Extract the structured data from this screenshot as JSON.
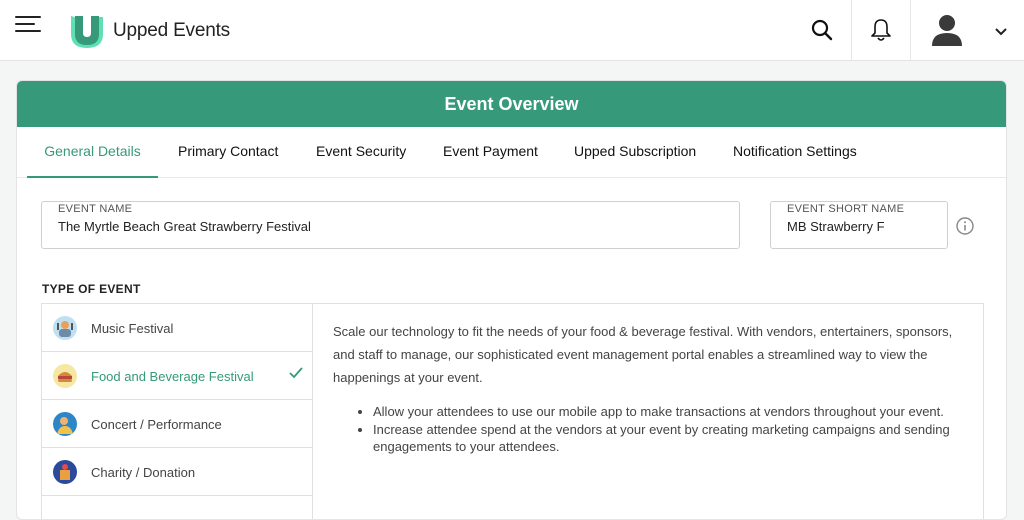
{
  "header": {
    "brand": "Upped Events",
    "icons": [
      "menu-icon",
      "upped-logo",
      "search-icon",
      "bell-icon",
      "user-avatar-icon",
      "chevron-down-icon"
    ]
  },
  "card": {
    "title": "Event Overview"
  },
  "tabs": [
    {
      "label": "General Details",
      "active": true
    },
    {
      "label": "Primary Contact",
      "active": false
    },
    {
      "label": "Event Security",
      "active": false
    },
    {
      "label": "Event Payment",
      "active": false
    },
    {
      "label": "Upped Subscription",
      "active": false
    },
    {
      "label": "Notification Settings",
      "active": false
    }
  ],
  "form": {
    "event_name": {
      "label": "EVENT NAME",
      "value": "The Myrtle Beach Great Strawberry Festival"
    },
    "event_short_name": {
      "label": "EVENT SHORT NAME",
      "value": "MB Strawberry F"
    }
  },
  "type_of_event": {
    "title": "TYPE OF EVENT",
    "items": [
      {
        "label": "Music Festival",
        "icon": "music-festival-icon",
        "selected": false
      },
      {
        "label": "Food and Beverage Festival",
        "icon": "food-festival-icon",
        "selected": true
      },
      {
        "label": "Concert / Performance",
        "icon": "concert-icon",
        "selected": false
      },
      {
        "label": "Charity / Donation",
        "icon": "charity-icon",
        "selected": false
      }
    ],
    "description": "Scale our technology to fit the needs of your food & beverage festival. With vendors, entertainers, sponsors, and staff to manage, our sophisticated event management portal enables a streamlined way to view the happenings at your event.",
    "bullets": [
      "Allow your attendees to use our mobile app to make transactions at vendors throughout your event.",
      " Increase attendee spend at the vendors at your event by creating marketing campaigns and sending engagements to your attendees."
    ]
  },
  "colors": {
    "accent": "#36997a",
    "text": "#222222",
    "border": "#e0e0e0"
  }
}
